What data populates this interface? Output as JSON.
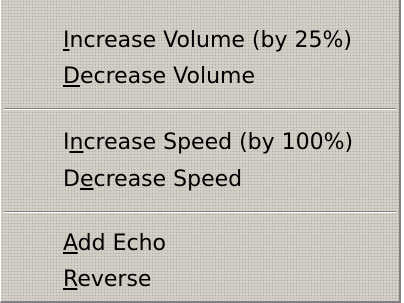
{
  "menu": {
    "items": [
      {
        "id": "increase-volume",
        "pre": "",
        "key": "I",
        "post": "ncrease Volume (by 25%)"
      },
      {
        "id": "decrease-volume",
        "pre": "",
        "key": "D",
        "post": "ecrease Volume"
      },
      {
        "id": "increase-speed",
        "pre": "I",
        "key": "n",
        "post": "crease Speed (by 100%)"
      },
      {
        "id": "decrease-speed",
        "pre": "D",
        "key": "e",
        "post": "crease Speed"
      },
      {
        "id": "add-echo",
        "pre": "",
        "key": "A",
        "post": "dd Echo"
      },
      {
        "id": "reverse",
        "pre": "",
        "key": "R",
        "post": "everse"
      }
    ]
  }
}
